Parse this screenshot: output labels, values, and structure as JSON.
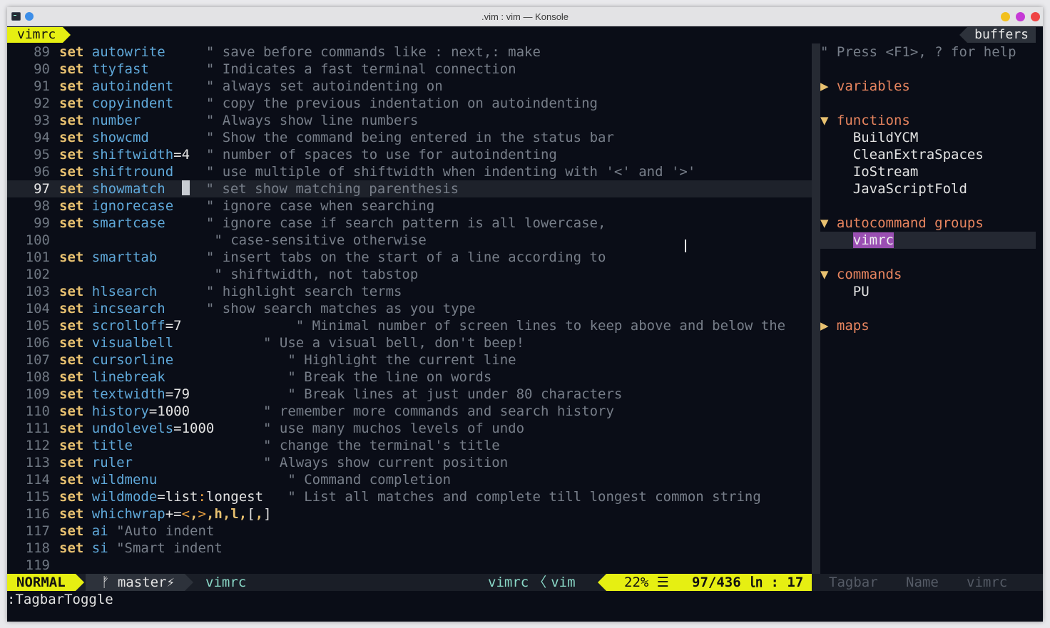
{
  "window": {
    "title": ".vim : vim — Konsole"
  },
  "tabline": {
    "left_tab": "vimrc",
    "right_tab": "buffers"
  },
  "editor": {
    "cursor_line": 97,
    "lines": [
      {
        "n": "89",
        "segments": [
          [
            "kw",
            "set"
          ],
          [
            "sp",
            " "
          ],
          [
            "opt",
            "autowrite"
          ],
          [
            "cm",
            "     \" save before commands like : next,: make"
          ]
        ]
      },
      {
        "n": "90",
        "segments": [
          [
            "kw",
            "set"
          ],
          [
            "sp",
            " "
          ],
          [
            "opt",
            "ttyfast"
          ],
          [
            "cm",
            "       \" Indicates a fast terminal connection"
          ]
        ]
      },
      {
        "n": "91",
        "segments": [
          [
            "kw",
            "set"
          ],
          [
            "sp",
            " "
          ],
          [
            "opt",
            "autoindent"
          ],
          [
            "cm",
            "    \" always set autoindenting on"
          ]
        ]
      },
      {
        "n": "92",
        "segments": [
          [
            "kw",
            "set"
          ],
          [
            "sp",
            " "
          ],
          [
            "opt",
            "copyindent"
          ],
          [
            "cm",
            "    \" copy the previous indentation on autoindenting"
          ]
        ]
      },
      {
        "n": "93",
        "segments": [
          [
            "kw",
            "set"
          ],
          [
            "sp",
            " "
          ],
          [
            "opt",
            "number"
          ],
          [
            "cm",
            "        \" Always show line numbers"
          ]
        ]
      },
      {
        "n": "94",
        "segments": [
          [
            "kw",
            "set"
          ],
          [
            "sp",
            " "
          ],
          [
            "opt",
            "showcmd"
          ],
          [
            "cm",
            "       \" Show the command being entered in the status bar"
          ]
        ]
      },
      {
        "n": "95",
        "segments": [
          [
            "kw",
            "set"
          ],
          [
            "sp",
            " "
          ],
          [
            "opt",
            "shiftwidth"
          ],
          [
            "plain",
            "=4"
          ],
          [
            "cm",
            "  \" number of spaces to use for autoindenting"
          ]
        ]
      },
      {
        "n": "96",
        "segments": [
          [
            "kw",
            "set"
          ],
          [
            "sp",
            " "
          ],
          [
            "opt",
            "shiftround"
          ],
          [
            "cm",
            "    \" use multiple of shiftwidth when indenting with '<' and '>'"
          ]
        ]
      },
      {
        "n": "97",
        "segments": [
          [
            "kw",
            "set"
          ],
          [
            "sp",
            " "
          ],
          [
            "opt",
            "showmatch"
          ],
          [
            "sp",
            "  "
          ],
          [
            "cursor",
            ""
          ],
          [
            "cm",
            "  \" set show matching parenthesis"
          ]
        ]
      },
      {
        "n": "98",
        "segments": [
          [
            "kw",
            "set"
          ],
          [
            "sp",
            " "
          ],
          [
            "opt",
            "ignorecase"
          ],
          [
            "cm",
            "    \" ignore case when searching"
          ]
        ]
      },
      {
        "n": "99",
        "segments": [
          [
            "kw",
            "set"
          ],
          [
            "sp",
            " "
          ],
          [
            "opt",
            "smartcase"
          ],
          [
            "cm",
            "     \" ignore case if search pattern is all lowercase,"
          ]
        ]
      },
      {
        "n": "100",
        "segments": [
          [
            "cm",
            "                   \" case-sensitive otherwise"
          ]
        ]
      },
      {
        "n": "101",
        "segments": [
          [
            "kw",
            "set"
          ],
          [
            "sp",
            " "
          ],
          [
            "opt",
            "smarttab"
          ],
          [
            "cm",
            "      \" insert tabs on the start of a line according to"
          ]
        ]
      },
      {
        "n": "102",
        "segments": [
          [
            "cm",
            "                   \" shiftwidth, not tabstop"
          ]
        ]
      },
      {
        "n": "103",
        "segments": [
          [
            "kw",
            "set"
          ],
          [
            "sp",
            " "
          ],
          [
            "opt",
            "hlsearch"
          ],
          [
            "cm",
            "      \" highlight search terms"
          ]
        ]
      },
      {
        "n": "104",
        "segments": [
          [
            "kw",
            "set"
          ],
          [
            "sp",
            " "
          ],
          [
            "opt",
            "incsearch"
          ],
          [
            "cm",
            "     \" show search matches as you type"
          ]
        ]
      },
      {
        "n": "105",
        "segments": [
          [
            "kw",
            "set"
          ],
          [
            "sp",
            " "
          ],
          [
            "opt",
            "scrolloff"
          ],
          [
            "plain",
            "=7"
          ],
          [
            "cm",
            "              \" Minimal number of screen lines to keep above and below the"
          ]
        ]
      },
      {
        "n": "106",
        "segments": [
          [
            "kw",
            "set"
          ],
          [
            "sp",
            " "
          ],
          [
            "opt",
            "visualbell"
          ],
          [
            "cm",
            "           \" Use a visual bell, don't beep!"
          ]
        ]
      },
      {
        "n": "107",
        "segments": [
          [
            "kw",
            "set"
          ],
          [
            "sp",
            " "
          ],
          [
            "opt",
            "cursorline"
          ],
          [
            "cm",
            "              \" Highlight the current line"
          ]
        ]
      },
      {
        "n": "108",
        "segments": [
          [
            "kw",
            "set"
          ],
          [
            "sp",
            " "
          ],
          [
            "opt",
            "linebreak"
          ],
          [
            "cm",
            "               \" Break the line on words"
          ]
        ]
      },
      {
        "n": "109",
        "segments": [
          [
            "kw",
            "set"
          ],
          [
            "sp",
            " "
          ],
          [
            "opt",
            "textwidth"
          ],
          [
            "plain",
            "=79"
          ],
          [
            "cm",
            "            \" Break lines at just under 80 characters"
          ]
        ]
      },
      {
        "n": "110",
        "segments": [
          [
            "kw",
            "set"
          ],
          [
            "sp",
            " "
          ],
          [
            "opt",
            "history"
          ],
          [
            "plain",
            "=1000"
          ],
          [
            "cm",
            "         \" remember more commands and search history"
          ]
        ]
      },
      {
        "n": "111",
        "segments": [
          [
            "kw",
            "set"
          ],
          [
            "sp",
            " "
          ],
          [
            "opt",
            "undolevels"
          ],
          [
            "plain",
            "=1000"
          ],
          [
            "cm",
            "      \" use many muchos levels of undo"
          ]
        ]
      },
      {
        "n": "112",
        "segments": [
          [
            "kw",
            "set"
          ],
          [
            "sp",
            " "
          ],
          [
            "opt",
            "title"
          ],
          [
            "cm",
            "                \" change the terminal's title"
          ]
        ]
      },
      {
        "n": "113",
        "segments": [
          [
            "kw",
            "set"
          ],
          [
            "sp",
            " "
          ],
          [
            "opt",
            "ruler"
          ],
          [
            "cm",
            "                \" Always show current position"
          ]
        ]
      },
      {
        "n": "114",
        "segments": [
          [
            "kw",
            "set"
          ],
          [
            "sp",
            " "
          ],
          [
            "opt",
            "wildmenu"
          ],
          [
            "cm",
            "                \" Command completion"
          ]
        ]
      },
      {
        "n": "115",
        "segments": [
          [
            "kw",
            "set"
          ],
          [
            "sp",
            " "
          ],
          [
            "opt",
            "wildmode"
          ],
          [
            "plain",
            "=list"
          ],
          [
            "sym",
            ":"
          ],
          [
            "plain",
            "longest"
          ],
          [
            "cm",
            "   \" List all matches and complete till longest common string"
          ]
        ]
      },
      {
        "n": "116",
        "segments": [
          [
            "kw",
            "set"
          ],
          [
            "sp",
            " "
          ],
          [
            "opt",
            "whichwrap"
          ],
          [
            "plain",
            "+="
          ],
          [
            "sym",
            "<"
          ],
          [
            "kw",
            ","
          ],
          [
            "sym",
            ">"
          ],
          [
            "kw",
            ",h,l,"
          ],
          [
            "plain",
            "["
          ],
          [
            "kw",
            ","
          ],
          [
            "plain",
            "]"
          ]
        ]
      },
      {
        "n": "117",
        "segments": [
          [
            "kw",
            "set"
          ],
          [
            "sp",
            " "
          ],
          [
            "opt",
            "ai"
          ],
          [
            "cm",
            " \"Auto indent"
          ]
        ]
      },
      {
        "n": "118",
        "segments": [
          [
            "kw",
            "set"
          ],
          [
            "sp",
            " "
          ],
          [
            "opt",
            "si"
          ],
          [
            "cm",
            " \"Smart indent"
          ]
        ]
      },
      {
        "n": "119",
        "segments": []
      }
    ]
  },
  "tagbar": {
    "help": "\" Press <F1>, ? for help",
    "groups": [
      {
        "arrow": "▶",
        "label": "variables",
        "items": []
      },
      {
        "arrow": "▼",
        "label": "functions",
        "items": [
          "BuildYCM",
          "CleanExtraSpaces",
          "IoStream",
          "JavaScriptFold"
        ]
      },
      {
        "arrow": "▼",
        "label": "autocommand groups",
        "items": [
          "vimrc"
        ],
        "selected": "vimrc"
      },
      {
        "arrow": "▼",
        "label": "commands",
        "items": [
          "PU"
        ]
      },
      {
        "arrow": "▶",
        "label": "maps",
        "items": []
      }
    ]
  },
  "statusline": {
    "mode": "NORMAL",
    "branch": "ᚠ master⚡",
    "filename": "vimrc",
    "filetype_left": "vimrc",
    "filetype_sep": "〈",
    "filetype_right": "vim",
    "percent": "22% ☰",
    "position": "97/436 ㏑ : 17",
    "tagbar_left": "Tagbar",
    "tagbar_mid": "Name",
    "tagbar_right": "vimrc"
  },
  "cmdline": ":TagbarToggle",
  "colors": {
    "accent": "#e6ef12",
    "keyword": "#e8c170",
    "option": "#5fa8d9",
    "comment": "#777e89",
    "kind": "#e8855f",
    "select": "#9a4fb2"
  }
}
